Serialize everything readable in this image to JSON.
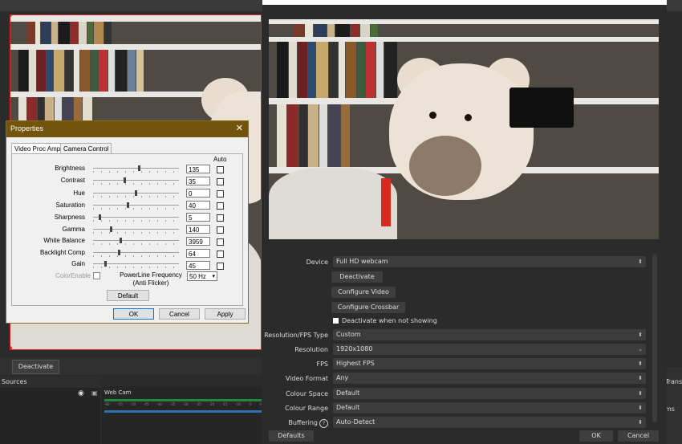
{
  "properties_dialog": {
    "title": "Properties",
    "close_icon": "close-icon",
    "tabs": [
      "Video Proc Amp",
      "Camera Control"
    ],
    "auto_label": "Auto",
    "rows": [
      {
        "label": "Brightness",
        "value": "135"
      },
      {
        "label": "Contrast",
        "value": "35"
      },
      {
        "label": "Hue",
        "value": "0"
      },
      {
        "label": "Saturation",
        "value": "40"
      },
      {
        "label": "Sharpness",
        "value": "5"
      },
      {
        "label": "Gamma",
        "value": "140"
      },
      {
        "label": "White Balance",
        "value": "3959"
      },
      {
        "label": "Backlight Comp",
        "value": "64"
      },
      {
        "label": "Gain",
        "value": "45"
      }
    ],
    "color_enable_label": "ColorEnable",
    "powerline_label_1": "PowerLine Frequency",
    "powerline_label_2": "(Anti Flicker)",
    "powerline_value": "50 Hz",
    "default_button": "Default",
    "ok_button": "OK",
    "cancel_button": "Cancel",
    "apply_button": "Apply"
  },
  "obs_main": {
    "deactivate_button": "Deactivate",
    "sources_title": "Sources",
    "mixer_source": "Web Cam",
    "meter_ticks": [
      "-60",
      "-55",
      "-50",
      "-45",
      "-40",
      "-35",
      "-30",
      "-25",
      "-20",
      "-15",
      "-10",
      "-5",
      "0"
    ],
    "right_strip_1": "Transi",
    "right_strip_2": "ms"
  },
  "obs_properties": {
    "fields": {
      "device_label": "Device",
      "device_value": "Full HD webcam",
      "deactivate_button": "Deactivate",
      "configure_video_button": "Configure Video",
      "configure_crossbar_button": "Configure Crossbar",
      "deactivate_when_not_showing": "Deactivate when not showing",
      "res_fps_type_label": "Resolution/FPS Type",
      "res_fps_type_value": "Custom",
      "resolution_label": "Resolution",
      "resolution_value": "1920x1080",
      "fps_label": "FPS",
      "fps_value": "Highest FPS",
      "video_format_label": "Video Format",
      "video_format_value": "Any",
      "colour_space_label": "Colour Space",
      "colour_space_value": "Default",
      "colour_range_label": "Colour Range",
      "colour_range_value": "Default",
      "buffering_label": "Buffering",
      "buffering_value": "Auto-Detect"
    },
    "defaults_button": "Defaults",
    "ok_button": "OK",
    "cancel_button": "Cancel"
  }
}
